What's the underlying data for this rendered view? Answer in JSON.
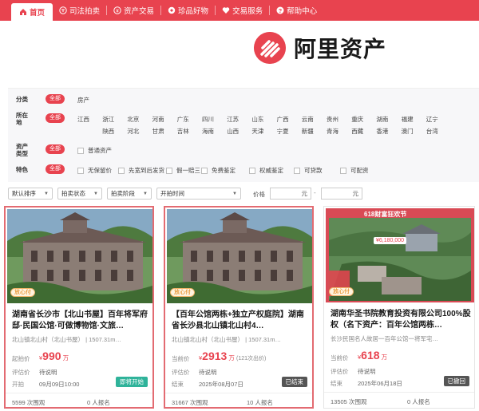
{
  "nav": {
    "items": [
      {
        "label": "首页",
        "icon": "home-icon"
      },
      {
        "label": "司法拍卖",
        "icon": "gavel-icon"
      },
      {
        "label": "资产交易",
        "icon": "coin-icon"
      },
      {
        "label": "珍品好物",
        "icon": "gem-icon"
      },
      {
        "label": "交易服务",
        "icon": "heart-icon"
      },
      {
        "label": "帮助中心",
        "icon": "help-icon"
      }
    ]
  },
  "brand": {
    "name": "阿里资产",
    "color": "#e8434f"
  },
  "filters": {
    "category": {
      "label": "分类",
      "all": "全部",
      "options": [
        "房产"
      ]
    },
    "location": {
      "label": "所在地",
      "all": "全部",
      "row1": [
        "江西",
        "浙江",
        "北京",
        "河南",
        "广东",
        "四川",
        "江苏",
        "山东",
        "广西",
        "云南",
        "贵州",
        "重庆",
        "湖南",
        "福建",
        "辽宁"
      ],
      "row2": [
        "陕西",
        "河北",
        "甘肃",
        "吉林",
        "海南",
        "山西",
        "天津",
        "宁夏",
        "新疆",
        "青海",
        "西藏",
        "香港",
        "澳门",
        "台湾"
      ]
    },
    "asset_type": {
      "label": "资产类型",
      "all": "全部",
      "options": [
        "普通资产"
      ]
    },
    "feature": {
      "label": "特色",
      "all": "全部",
      "options": [
        "无保留价",
        "先宽到后发货",
        "假一赔三",
        "免费鉴定",
        "权威鉴定",
        "可贷款",
        "可配资"
      ]
    }
  },
  "sortbar": {
    "default_sort": "默认排序",
    "auction_status": "拍卖状态",
    "auction_stage": "拍卖阶段",
    "start_time": "开拍时间",
    "price_label": "价格",
    "unit": "元",
    "dash": "-"
  },
  "cards": [
    {
      "tag": "放心付",
      "title": "湖南省长沙市【北山书屋】百年将军府邸·民国公馆·可做博物馆·文旅…",
      "sub": "北山镇北山村（北山书屋） | 1507.31m…",
      "price_label": "起拍价",
      "price_prefix": "¥",
      "price": "990",
      "price_unit": "万",
      "eval_label": "评估价",
      "eval": "待说明",
      "row3_label": "开拍",
      "row3_value": "09月09日10:00",
      "badge": "即将开始",
      "badge_color": "#2fb39a",
      "views": "5599 次围观",
      "signups": "0 人报名"
    },
    {
      "tag": "放心付",
      "title": "【百年公馆两栋+独立产权庭院】湖南省长沙县北山镇北山村4…",
      "sub": "北山镇北山村（北山书屋） | 1507.31m…",
      "price_label": "当前价",
      "price_prefix": "¥",
      "price": "2913",
      "price_unit": "万",
      "price_note": "(121次出价)",
      "eval_label": "评估价",
      "eval": "待说明",
      "row3_label": "结束",
      "row3_value": "2025年08月07日",
      "badge": "已结束",
      "badge_color": "#555555",
      "views": "31667 次围观",
      "signups": "10 人报名"
    },
    {
      "tag": "放心付",
      "banner": "618财富狂欢节",
      "banner_price": "¥6,180,000",
      "title": "湖南华圣书院教育投资有限公司100%股权（名下资产：百年公馆两栋…",
      "sub": "长沙民国名人故居一百年公馆一将军宅…",
      "price_label": "当前价",
      "price_prefix": "¥",
      "price": "618",
      "price_unit": "万",
      "eval_label": "评估价",
      "eval": "待说明",
      "row3_label": "结束",
      "row3_value": "2025年06月18日",
      "badge": "已撤回",
      "badge_color": "#555555",
      "views": "13505 次围观",
      "signups": "0 人报名"
    }
  ]
}
